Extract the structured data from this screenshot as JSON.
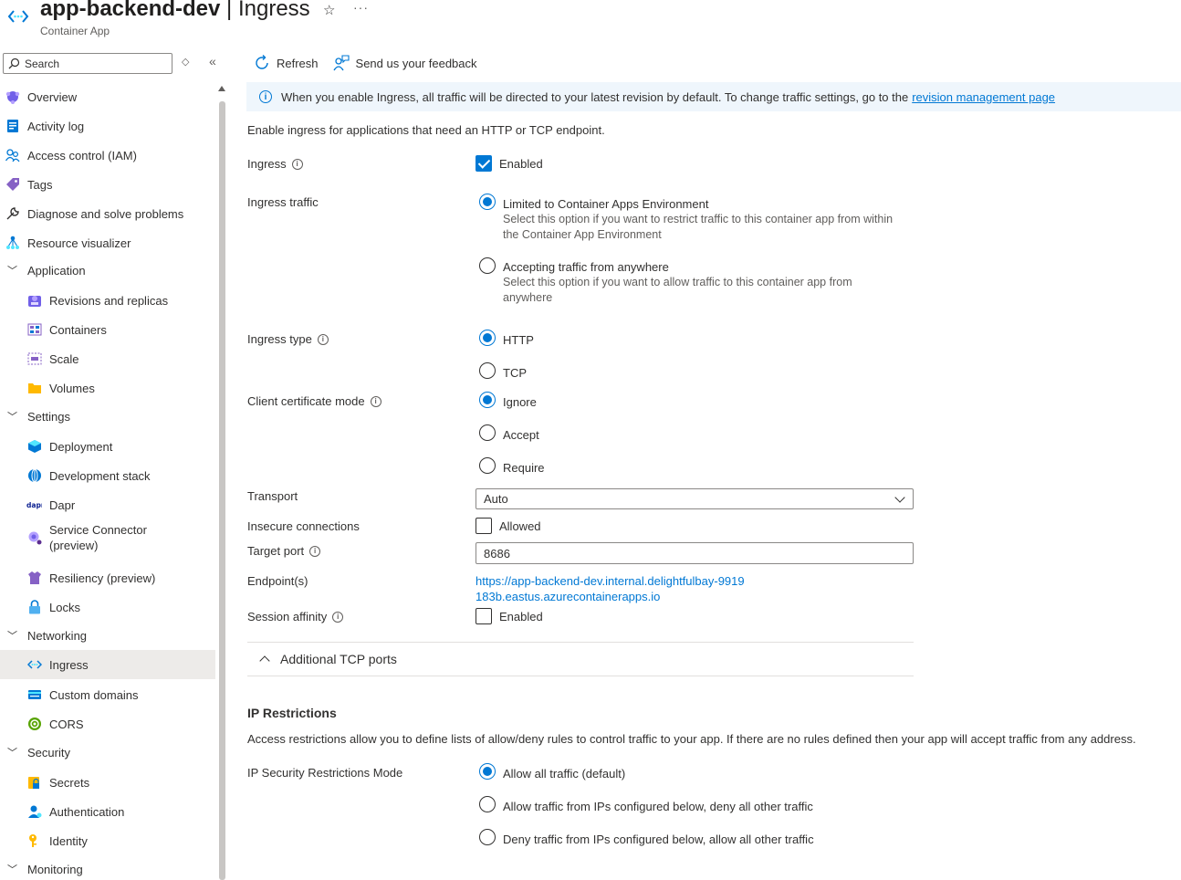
{
  "header": {
    "title": "app-backend-dev",
    "section": "Ingress",
    "separator": " | ",
    "subtitle": "Container App",
    "star_icon": "star-icon",
    "more_icon": "more-icon"
  },
  "sidebar": {
    "search_placeholder": "Search",
    "items": [
      {
        "label": "Overview",
        "icon": "overview-icon"
      },
      {
        "label": "Activity log",
        "icon": "activity-log-icon"
      },
      {
        "label": "Access control (IAM)",
        "icon": "iam-icon"
      },
      {
        "label": "Tags",
        "icon": "tag-icon"
      },
      {
        "label": "Diagnose and solve problems",
        "icon": "wrench-icon"
      },
      {
        "label": "Resource visualizer",
        "icon": "visualizer-icon"
      },
      {
        "label": "Application",
        "group": true
      },
      {
        "label": "Revisions and replicas",
        "icon": "revisions-icon"
      },
      {
        "label": "Containers",
        "icon": "containers-icon"
      },
      {
        "label": "Scale",
        "icon": "scale-icon"
      },
      {
        "label": "Volumes",
        "icon": "folder-icon"
      },
      {
        "label": "Settings",
        "group": true
      },
      {
        "label": "Deployment",
        "icon": "deployment-icon"
      },
      {
        "label": "Development stack",
        "icon": "dev-stack-icon"
      },
      {
        "label": "Dapr",
        "icon": "dapr-icon"
      },
      {
        "label": "Service Connector (preview)",
        "icon": "service-connector-icon"
      },
      {
        "label": "Resiliency (preview)",
        "icon": "resiliency-icon"
      },
      {
        "label": "Locks",
        "icon": "lock-icon"
      },
      {
        "label": "Networking",
        "group": true
      },
      {
        "label": "Ingress",
        "icon": "ingress-icon",
        "selected": true
      },
      {
        "label": "Custom domains",
        "icon": "custom-domains-icon"
      },
      {
        "label": "CORS",
        "icon": "cors-icon"
      },
      {
        "label": "Security",
        "group": true
      },
      {
        "label": "Secrets",
        "icon": "secrets-icon"
      },
      {
        "label": "Authentication",
        "icon": "authentication-icon"
      },
      {
        "label": "Identity",
        "icon": "identity-icon"
      },
      {
        "label": "Monitoring",
        "group": true
      }
    ]
  },
  "toolbar": {
    "refresh": "Refresh",
    "feedback": "Send us your feedback"
  },
  "info": {
    "text": "When you enable Ingress, all traffic will be directed to your latest revision by default. To change traffic settings, go to the",
    "link": "revision management page"
  },
  "form": {
    "description": "Enable ingress for applications that need an HTTP or TCP endpoint.",
    "ingress": {
      "label": "Ingress",
      "checkbox_label": "Enabled",
      "checked": true
    },
    "ingress_traffic": {
      "label": "Ingress traffic",
      "options": [
        {
          "label": "Limited to Container Apps Environment",
          "desc": "Select this option if you want to restrict traffic to this container app from within the Container App Environment",
          "selected": true
        },
        {
          "label": "Accepting traffic from anywhere",
          "desc": "Select this option if you want to allow traffic to this container app from anywhere",
          "selected": false
        }
      ]
    },
    "ingress_type": {
      "label": "Ingress type",
      "options": [
        {
          "label": "HTTP",
          "selected": true
        },
        {
          "label": "TCP",
          "selected": false
        }
      ]
    },
    "client_cert": {
      "label": "Client certificate mode",
      "options": [
        {
          "label": "Ignore",
          "selected": true
        },
        {
          "label": "Accept",
          "selected": false
        },
        {
          "label": "Require",
          "selected": false
        }
      ]
    },
    "transport": {
      "label": "Transport",
      "value": "Auto"
    },
    "insecure": {
      "label": "Insecure connections",
      "checkbox_label": "Allowed",
      "checked": false
    },
    "target_port": {
      "label": "Target port",
      "value": "8686"
    },
    "endpoints": {
      "label": "Endpoint(s)",
      "value": "https://app-backend-dev.internal.delightfulbay-9919183b.eastus.azurecontainerapps.io"
    },
    "session_affinity": {
      "label": "Session affinity",
      "checkbox_label": "Enabled",
      "checked": false
    },
    "additional_tcp": "Additional TCP ports"
  },
  "ip_restrictions": {
    "heading": "IP Restrictions",
    "description": "Access restrictions allow you to define lists of allow/deny rules to control traffic to your app. If there are no rules defined then your app will accept traffic from any address.",
    "mode_label": "IP Security Restrictions Mode",
    "options": [
      {
        "label": "Allow all traffic (default)",
        "selected": true
      },
      {
        "label": "Allow traffic from IPs configured below, deny all other traffic",
        "selected": false
      },
      {
        "label": "Deny traffic from IPs configured below, allow all other traffic",
        "selected": false
      }
    ]
  },
  "colors": {
    "accent": "#0078d4",
    "info_bg": "#eff6fc",
    "selected_bg": "#edebe9"
  }
}
